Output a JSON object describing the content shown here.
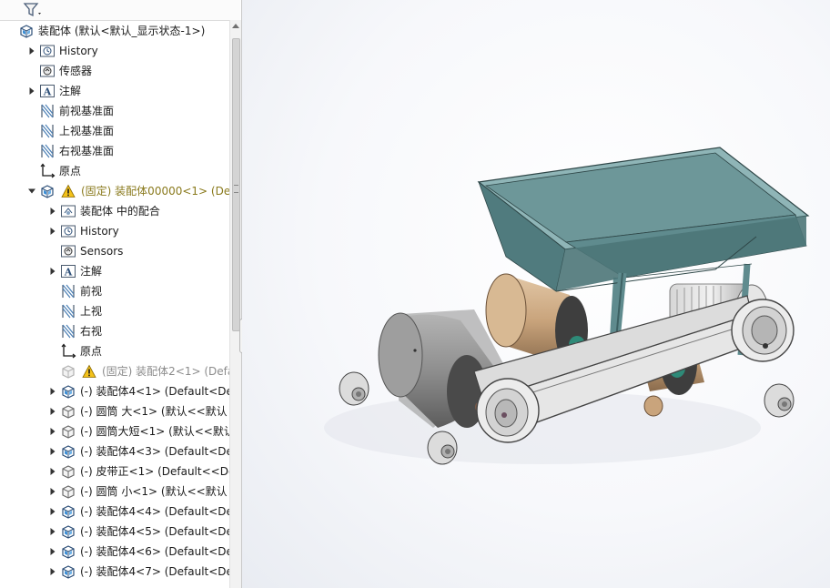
{
  "tree": {
    "rows": [
      {
        "label": "装配体  (默认<默认_显示状态-1>)",
        "icon": "assembly-icon",
        "expander": "none",
        "indent": 0
      },
      {
        "label": "History",
        "icon": "history-folder-icon",
        "expander": "collapsed",
        "indent": 1
      },
      {
        "label": "传感器",
        "icon": "sensors-folder-icon",
        "expander": "none",
        "indent": 1
      },
      {
        "label": "注解",
        "icon": "annotations-icon",
        "expander": "collapsed",
        "indent": 1
      },
      {
        "label": "前视基准面",
        "icon": "plane-icon",
        "expander": "none",
        "indent": 1
      },
      {
        "label": "上视基准面",
        "icon": "plane-icon",
        "expander": "none",
        "indent": 1
      },
      {
        "label": "右视基准面",
        "icon": "plane-icon",
        "expander": "none",
        "indent": 1
      },
      {
        "label": "原点",
        "icon": "origin-icon",
        "expander": "none",
        "indent": 1
      },
      {
        "label": "(固定) 装配体00000<1> (Def",
        "icon": "assembly-icon",
        "expander": "expanded",
        "indent": 1,
        "warning": true,
        "style": "warncolor"
      },
      {
        "label": "装配体 中的配合",
        "icon": "mates-folder-icon",
        "expander": "collapsed",
        "indent": 2
      },
      {
        "label": "History",
        "icon": "history-folder-icon",
        "expander": "collapsed",
        "indent": 2
      },
      {
        "label": "Sensors",
        "icon": "sensors-folder-icon",
        "expander": "none",
        "indent": 2
      },
      {
        "label": "注解",
        "icon": "annotations-icon",
        "expander": "collapsed",
        "indent": 2
      },
      {
        "label": "前视",
        "icon": "plane-icon",
        "expander": "none",
        "indent": 2
      },
      {
        "label": "上视",
        "icon": "plane-icon",
        "expander": "none",
        "indent": 2
      },
      {
        "label": "右视",
        "icon": "plane-icon",
        "expander": "none",
        "indent": 2
      },
      {
        "label": "原点",
        "icon": "origin-icon",
        "expander": "none",
        "indent": 2
      },
      {
        "label": "(固定) 装配体2<1> (Defa",
        "icon": "assembly-suppressed-icon",
        "expander": "none",
        "indent": 2,
        "warning": true,
        "style": "grey"
      },
      {
        "label": "(-) 装配体4<1> (Default<De",
        "icon": "assembly-icon",
        "expander": "collapsed",
        "indent": 2
      },
      {
        "label": "(-) 圆筒  大<1> (默认<<默认",
        "icon": "part-icon",
        "expander": "collapsed",
        "indent": 2
      },
      {
        "label": "(-) 圆筒大短<1> (默认<<默认",
        "icon": "part-icon",
        "expander": "collapsed",
        "indent": 2
      },
      {
        "label": "(-) 装配体4<3> (Default<De",
        "icon": "assembly-icon",
        "expander": "collapsed",
        "indent": 2
      },
      {
        "label": "(-) 皮带正<1> (Default<<De",
        "icon": "part-icon",
        "expander": "collapsed",
        "indent": 2
      },
      {
        "label": "(-) 圆筒  小<1> (默认<<默认",
        "icon": "part-icon",
        "expander": "collapsed",
        "indent": 2
      },
      {
        "label": "(-) 装配体4<4> (Default<De",
        "icon": "assembly-icon",
        "expander": "collapsed",
        "indent": 2
      },
      {
        "label": "(-) 装配体4<5> (Default<De",
        "icon": "assembly-icon",
        "expander": "collapsed",
        "indent": 2
      },
      {
        "label": "(-) 装配体4<6> (Default<De",
        "icon": "assembly-icon",
        "expander": "collapsed",
        "indent": 2
      },
      {
        "label": "(-) 装配体4<7> (Default<De",
        "icon": "assembly-icon",
        "expander": "collapsed",
        "indent": 2
      }
    ]
  },
  "colors": {
    "warning_text": "#8a7a1d",
    "suppressed_text": "#8c8c8c",
    "hopper": "#5f8b8e",
    "drum_tan": "#c9a47c",
    "drum_grey": "#8e8e8e",
    "frame": "#5f8b8e"
  }
}
